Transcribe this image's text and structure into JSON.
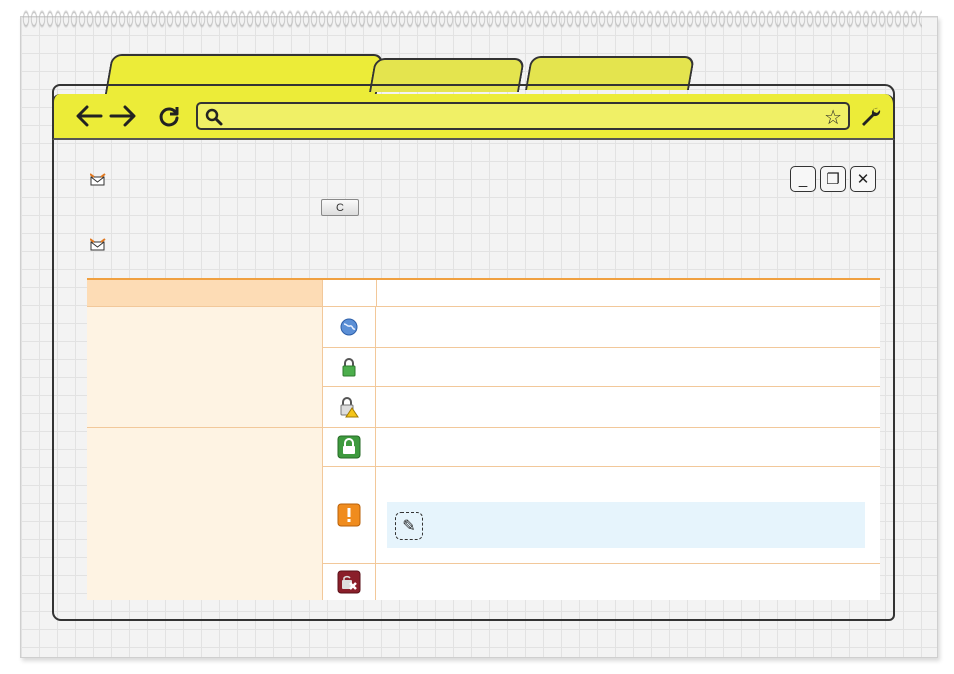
{
  "browser": {
    "tabs": [
      "",
      "",
      ""
    ],
    "address_bar_value": "",
    "icons": {
      "back": "back-arrow-icon",
      "forward": "forward-arrow-icon",
      "reload": "reload-icon",
      "search": "search-icon",
      "bookmark": "star-icon",
      "menu": "wrench-icon"
    }
  },
  "window_controls": [
    "_",
    "❐",
    "✕"
  ],
  "content": {
    "reload_button_label": "C",
    "table": {
      "headers": [
        "",
        "",
        ""
      ],
      "rows": [
        {
          "group": "",
          "icon": "globe-icon",
          "description": ""
        },
        {
          "group": "",
          "icon": "lock-icon",
          "description": ""
        },
        {
          "group": "",
          "icon": "lock-warning-icon",
          "description": ""
        },
        {
          "group": "",
          "icon": "green-lock-icon",
          "description": ""
        },
        {
          "group": "",
          "icon": "orange-alert-icon",
          "description": "",
          "note": ""
        },
        {
          "group": "",
          "icon": "red-lock-error-icon",
          "description": ""
        }
      ]
    }
  },
  "colors": {
    "toolbar": "#ecec38",
    "table_accent": "#f0a040",
    "header_fill": "#fddcb5",
    "group_fill": "#fef3e3",
    "note_fill": "#e6f4fc"
  }
}
